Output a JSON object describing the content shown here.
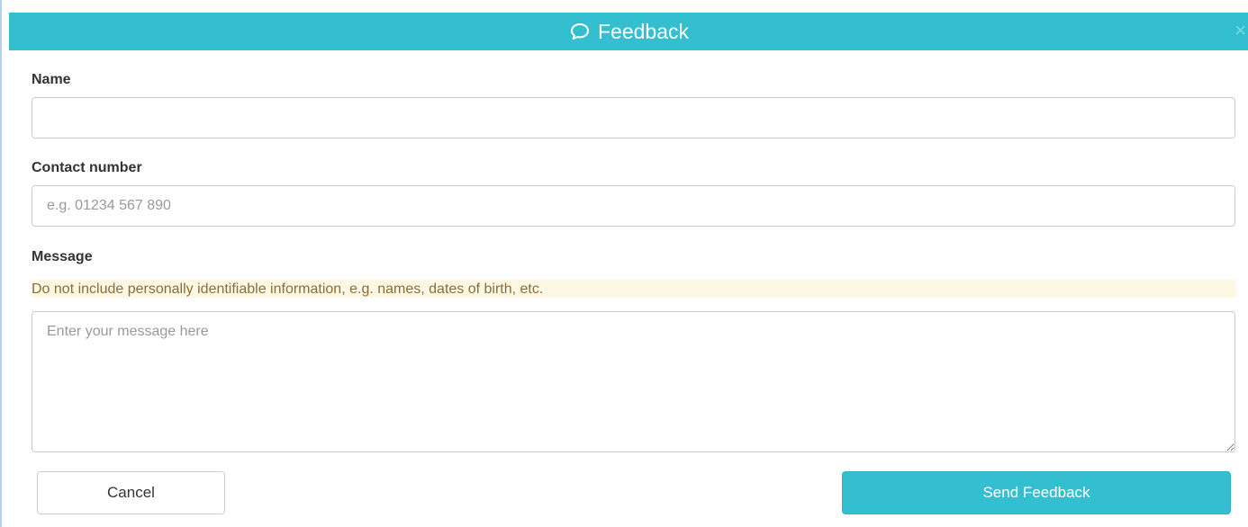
{
  "dialog": {
    "title": "Feedback",
    "close_glyph": "×",
    "header_icon": "chat-bubble-icon",
    "accent_color": "#34bfd0"
  },
  "form": {
    "name": {
      "label": "Name",
      "value": "",
      "placeholder": ""
    },
    "contact": {
      "label": "Contact number",
      "value": "",
      "placeholder": "e.g. 01234 567 890"
    },
    "message": {
      "label": "Message",
      "warning": "Do not include personally identifiable information, e.g. names, dates of birth, etc.",
      "value": "",
      "placeholder": "Enter your message here"
    }
  },
  "actions": {
    "cancel_label": "Cancel",
    "send_label": "Send Feedback"
  }
}
